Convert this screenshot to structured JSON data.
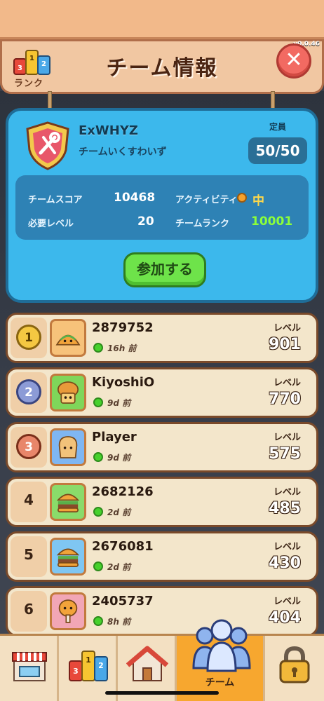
{
  "version": "v0.0.46",
  "header": {
    "title": "チーム情報",
    "rank_label": "ランク",
    "close_symbol": "✕",
    "rank_podium": [
      "1",
      "2",
      "3"
    ]
  },
  "team": {
    "name": "ExWHYZ",
    "motto": "チームいくすわいず",
    "capacity_label": "定員",
    "capacity": "50/50",
    "stats": {
      "score_label": "チームスコア",
      "score_value": "10468",
      "activity_label": "アクティビティ",
      "activity_value": "中",
      "level_label": "必要レベル",
      "level_value": "20",
      "rank_label": "チームランク",
      "rank_value": "10001"
    },
    "join_label": "参加する"
  },
  "members": [
    {
      "rank": "1",
      "name": "2879752",
      "last_seen": "16h 前",
      "level_label": "レベル",
      "level": "901"
    },
    {
      "rank": "2",
      "name": "KiyoshiO",
      "last_seen": "9d 前",
      "level_label": "レベル",
      "level": "770"
    },
    {
      "rank": "3",
      "name": "Player",
      "last_seen": "9d 前",
      "level_label": "レベル",
      "level": "575"
    },
    {
      "rank": "4",
      "name": "2682126",
      "last_seen": "2d 前",
      "level_label": "レベル",
      "level": "485"
    },
    {
      "rank": "5",
      "name": "2676081",
      "last_seen": "2d 前",
      "level_label": "レベル",
      "level": "430"
    },
    {
      "rank": "6",
      "name": "2405737",
      "last_seen": "8h 前",
      "level_label": "レベル",
      "level": "404"
    }
  ],
  "nav": {
    "items": [
      "shop-icon",
      "ranking-icon",
      "home-icon",
      "team-icon",
      "locked-icon"
    ],
    "active_label": "チーム",
    "podium": [
      "1",
      "2",
      "3"
    ]
  },
  "colors": {
    "team_card": "#3cb8ec",
    "join_button": "#6ee34a",
    "team_rank_value": "#8cff3a",
    "nav_active": "#f7a72f"
  }
}
